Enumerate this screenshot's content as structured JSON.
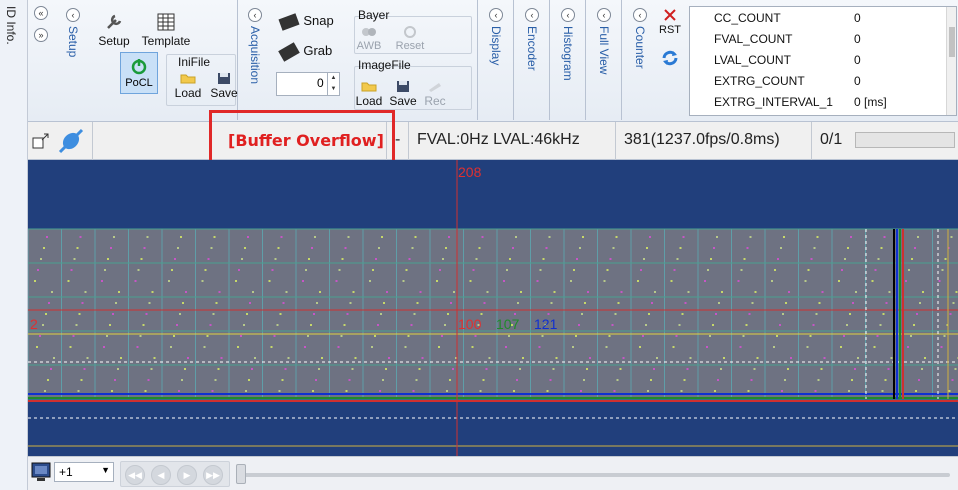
{
  "side_tab": {
    "label": "ID Info."
  },
  "ribbon": {
    "groups": {
      "setup": "Setup",
      "acquisition": "Acquisition",
      "display": "Display",
      "encoder": "Encoder",
      "histogram": "Histogram",
      "full_view": "Full View",
      "counter": "Counter"
    },
    "setup_label": "Setup",
    "template_label": "Template",
    "pocl_label": "PoCL",
    "inifile": {
      "title": "IniFile",
      "load": "Load",
      "save": "Save"
    },
    "snap_label": "Snap",
    "grab_label": "Grab",
    "grab_count": "0",
    "bayer": {
      "title": "Bayer",
      "awb": "AWB",
      "reset": "Reset"
    },
    "imagefile": {
      "title": "ImageFile",
      "load": "Load",
      "save": "Save",
      "rec": "Rec"
    },
    "rst_label": "RST"
  },
  "counters": [
    {
      "name": "CC_COUNT",
      "value": "0"
    },
    {
      "name": "FVAL_COUNT",
      "value": "0"
    },
    {
      "name": "LVAL_COUNT",
      "value": "0"
    },
    {
      "name": "EXTRG_COUNT",
      "value": "0"
    },
    {
      "name": "EXTRG_INTERVAL_1",
      "value": "0 [ms]"
    }
  ],
  "status": {
    "overflow": "[Buffer Overflow]",
    "dash": "-",
    "freq": "FVAL:0Hz  LVAL:46kHz",
    "frames": "381(1237.0fps/0.8ms)",
    "buffer": "0/1",
    "progress_fraction": 0
  },
  "viewport": {
    "cursor_x": "208",
    "cursor_y": "2",
    "r": "100",
    "g": "107",
    "b": "121",
    "colors": {
      "bg": "#213f7c",
      "red": "#d03030",
      "green": "#1f8a2a",
      "blue": "#1030d0"
    }
  },
  "bottom": {
    "zoom": "+1"
  }
}
